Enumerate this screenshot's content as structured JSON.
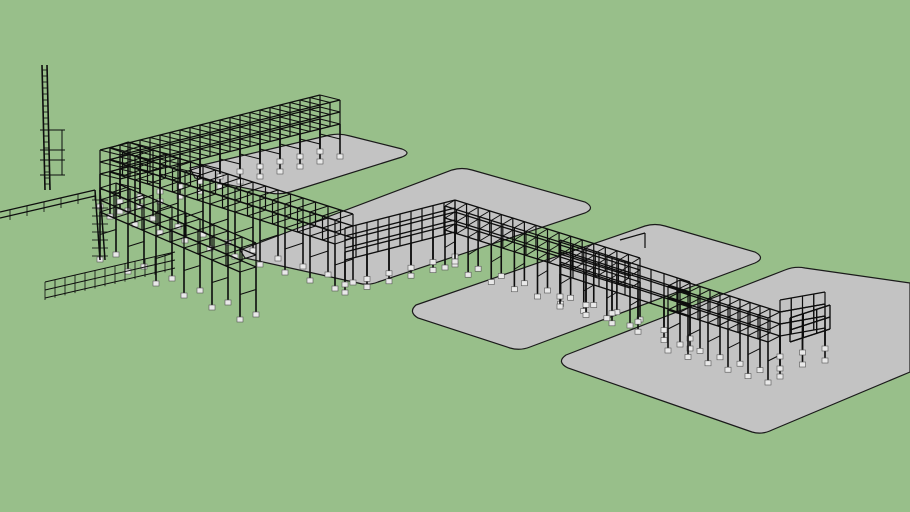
{
  "colors": {
    "background": "#98bf8a",
    "pad_fill": "#c3c3c3",
    "pad_edge": "#1a1a1a",
    "structure": "#0d0d0d",
    "footing": "#e8e8e8"
  }
}
